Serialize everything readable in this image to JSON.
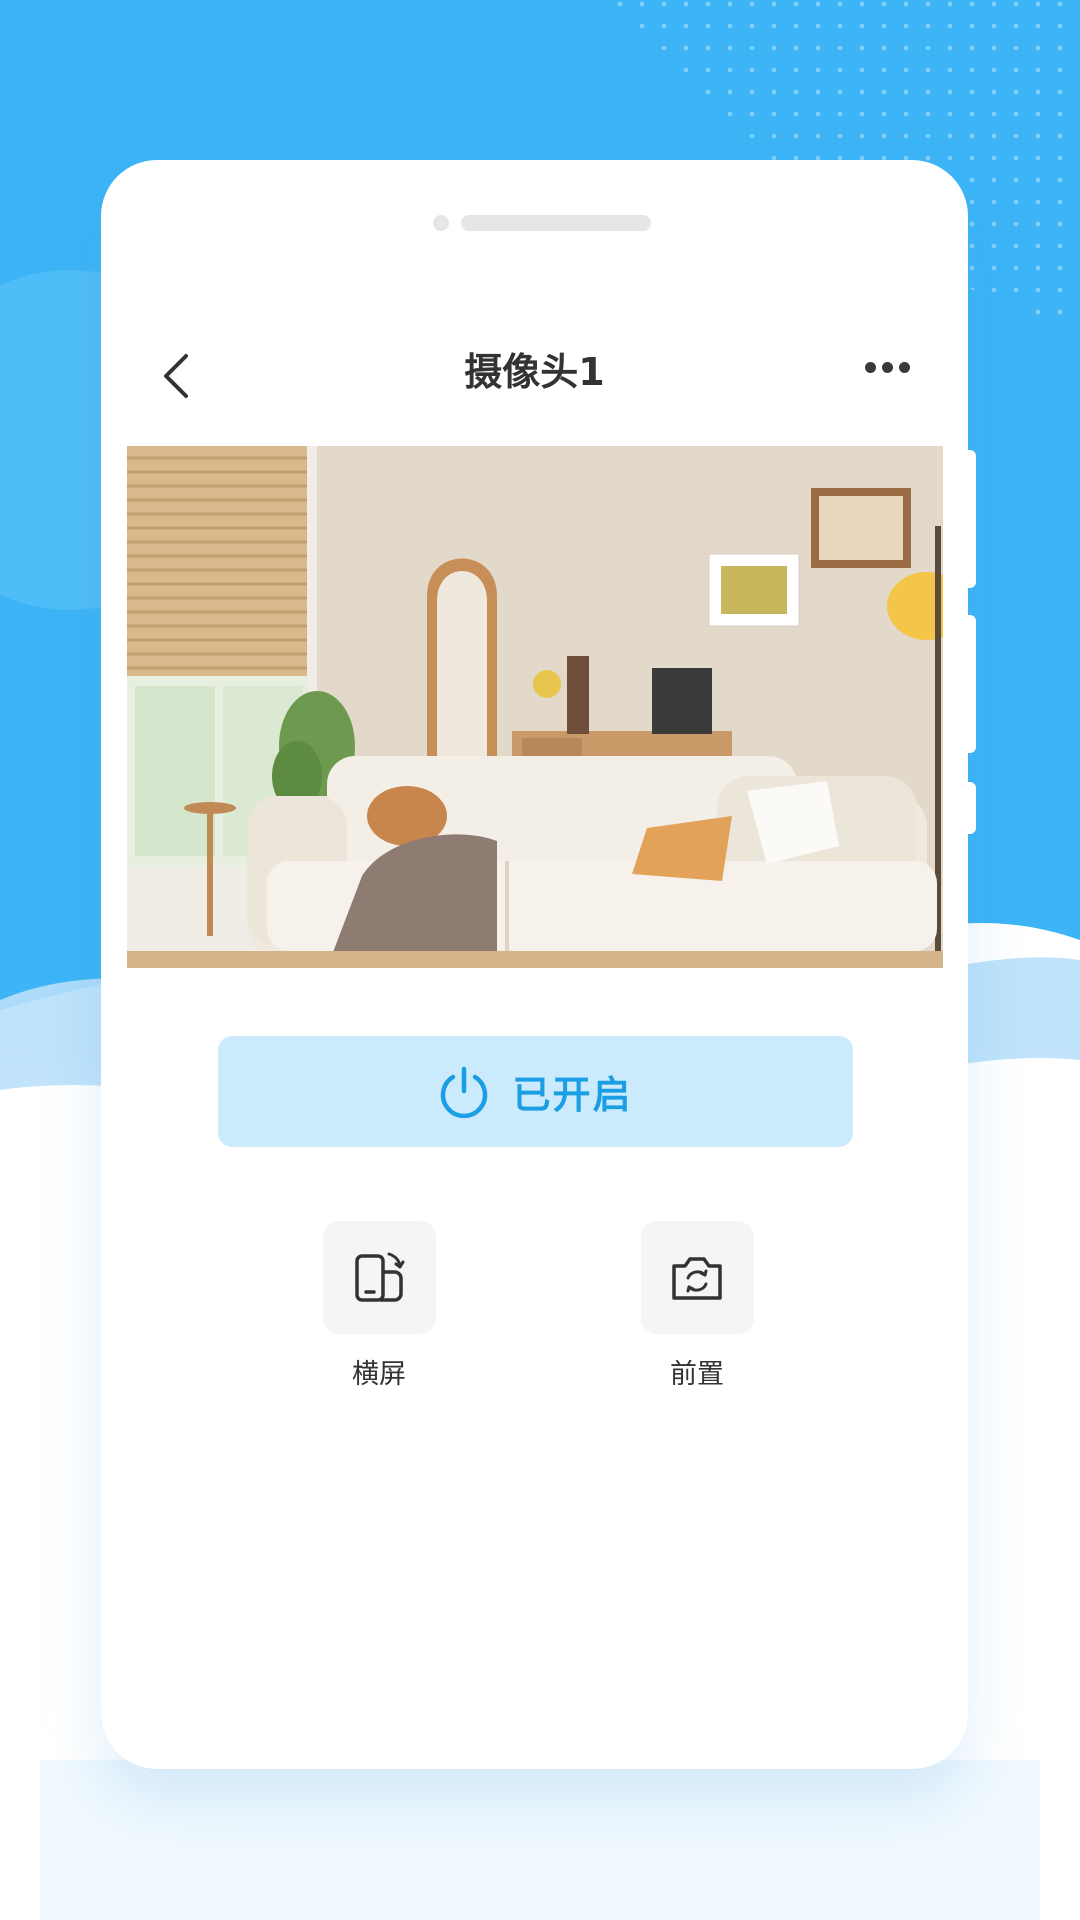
{
  "header": {
    "title": "摄像头1"
  },
  "power": {
    "label": "已开启",
    "state": "on",
    "accent_color": "#1b9ee3",
    "background_color": "#cbeafc"
  },
  "actions": [
    {
      "label": "横屏",
      "icon": "rotate-screen-icon"
    },
    {
      "label": "前置",
      "icon": "camera-switch-icon"
    }
  ],
  "theme": {
    "sky_blue": "#3cb4f6",
    "wave_light": "#b8e0fb"
  }
}
